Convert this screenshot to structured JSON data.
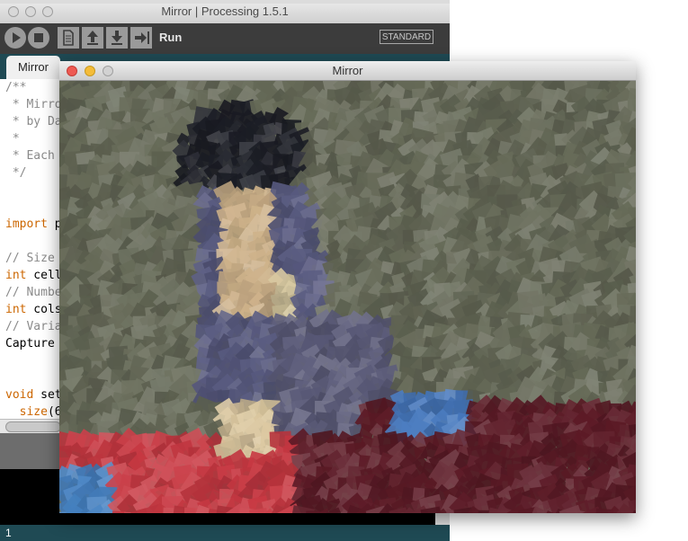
{
  "ide": {
    "title": "Mirror | Processing 1.5.1",
    "toolbar": {
      "run_label": "Run",
      "mode_label": "STANDARD"
    },
    "tab": {
      "label": "Mirror"
    },
    "code_lines": [
      {
        "text": "/**",
        "kind": "comment"
      },
      {
        "text": " * Mirro",
        "kind": "comment"
      },
      {
        "text": " * by Da",
        "kind": "comment"
      },
      {
        "text": " *",
        "kind": "comment"
      },
      {
        "text": " * Each",
        "kind": "comment"
      },
      {
        "text": " */",
        "kind": "comment"
      },
      {
        "text": "",
        "kind": "plain"
      },
      {
        "text": "",
        "kind": "plain"
      },
      {
        "text": "import p",
        "kind": "keyword-import"
      },
      {
        "text": "",
        "kind": "plain"
      },
      {
        "text": "// Size",
        "kind": "comment"
      },
      {
        "text": "int cell",
        "kind": "keyword-int"
      },
      {
        "text": "// Numbe",
        "kind": "comment"
      },
      {
        "text": "int cols",
        "kind": "keyword-int"
      },
      {
        "text": "// Varia",
        "kind": "comment"
      },
      {
        "text": "Capture",
        "kind": "type"
      },
      {
        "text": "",
        "kind": "plain"
      },
      {
        "text": "",
        "kind": "plain"
      },
      {
        "text": "void set",
        "kind": "keyword-void"
      },
      {
        "text": "  size(6",
        "kind": "call"
      }
    ],
    "status": {
      "line_number": "1"
    }
  },
  "sketch": {
    "title": "Mirror"
  },
  "colors": {
    "comment": "#8a8a8a",
    "keyword": "#cc6600",
    "type": "#000000",
    "toolbar_bg": "#3c3c3c",
    "tabbar_bg": "#1f4a54",
    "console_bg": "#000000"
  },
  "icons": {
    "run": "play-icon",
    "stop": "stop-icon",
    "new": "new-file-icon",
    "open": "open-icon",
    "save": "save-icon",
    "export": "export-icon"
  }
}
